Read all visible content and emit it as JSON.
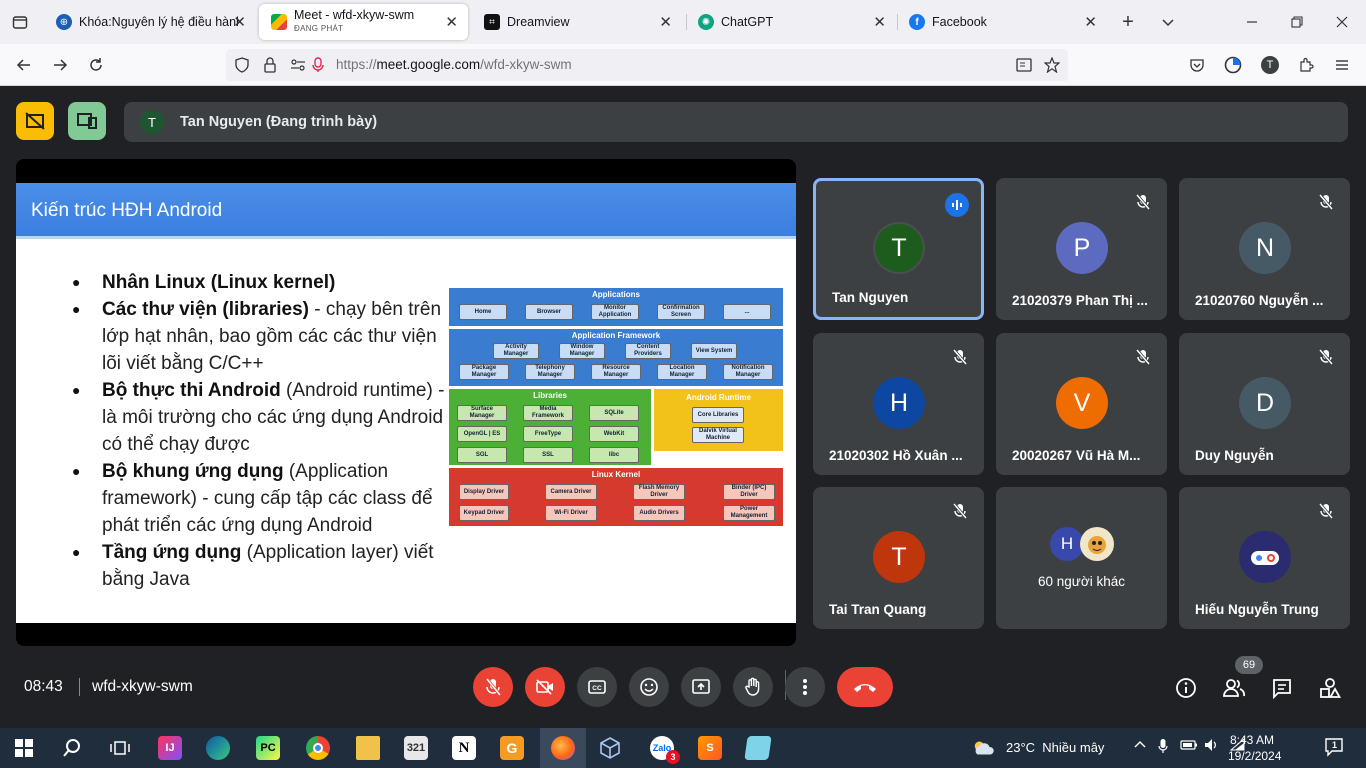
{
  "browser": {
    "tabs": [
      {
        "title": "Khóa:Nguyên lý hệ điều hành",
        "favicon": "moodle-icon",
        "active": false
      },
      {
        "title": "Meet - wfd-xkyw-swm",
        "subtitle": "ĐANG PHÁT",
        "favicon": "google-meet-icon",
        "active": true
      },
      {
        "title": "Dreamview",
        "favicon": "dreamview-icon",
        "active": false
      },
      {
        "title": "ChatGPT",
        "favicon": "chatgpt-icon",
        "active": false
      },
      {
        "title": "Facebook",
        "favicon": "facebook-icon",
        "active": false
      }
    ],
    "url": {
      "prefix": "https://",
      "host": "meet.google.com",
      "path": "/wfd-xkyw-swm"
    },
    "profile_initial": "T"
  },
  "meet": {
    "presenter": {
      "initial": "T",
      "label": "Tan Nguyen (Đang trình bày)"
    },
    "slide": {
      "title": "Kiến trúc HĐH Android",
      "bullets": [
        {
          "bold": "Nhân Linux (Linux kernel)",
          "rest": ""
        },
        {
          "bold": "Các thư viện (libraries)",
          "rest": " - chạy bên trên lớp hạt nhân, bao gồm các các thư viện lõi viết bằng C/C++"
        },
        {
          "bold": "Bộ thực thi Android",
          "rest": " (Android runtime) - là môi trường cho các ứng dụng Android có thể chạy được"
        },
        {
          "bold": "Bộ khung ứng dụng",
          "rest": " (Application framework) - cung cấp tập các class để phát triển các ứng dụng Android"
        },
        {
          "bold": "Tầng ứng dụng",
          "rest": " (Application layer) viết bằng Java"
        }
      ],
      "diagram": {
        "applications": {
          "title": "Applications",
          "items": [
            "Home",
            "Browser",
            "Monitor Application",
            "Confirmation Screen",
            "..."
          ]
        },
        "framework": {
          "title": "Application Framework",
          "row1": [
            "Activity Manager",
            "Window Manager",
            "Content Providers",
            "View System"
          ],
          "row2": [
            "Package Manager",
            "Telephony Manager",
            "Resource Manager",
            "Location Manager",
            "Notification Manager"
          ]
        },
        "libraries": {
          "title": "Libraries",
          "items": [
            "Surface Manager",
            "Media Framework",
            "SQLite",
            "OpenGL | ES",
            "FreeType",
            "WebKit",
            "SGL",
            "SSL",
            "libc"
          ]
        },
        "runtime": {
          "title": "Android Runtime",
          "items": [
            "Core Libraries",
            "Dalvik Virtual Machine"
          ]
        },
        "kernel": {
          "title": "Linux Kernel",
          "items": [
            "Display Driver",
            "Camera Driver",
            "Flash Memory Driver",
            "Binder (IPC) Driver",
            "Keypad Driver",
            "Wi-Fi Driver",
            "Audio Drivers",
            "Power Management"
          ]
        }
      }
    },
    "participants": [
      {
        "initial": "T",
        "name": "Tan Nguyen",
        "color": "#1e5c1e",
        "speaking": true
      },
      {
        "initial": "P",
        "name": "21020379 Phan Thị ...",
        "color": "#5c6bc0",
        "speaking": false
      },
      {
        "initial": "N",
        "name": "21020760 Nguyễn ...",
        "color": "#455a64",
        "speaking": false
      },
      {
        "initial": "H",
        "name": "21020302 Hồ Xuân ...",
        "color": "#0d47a1",
        "speaking": false
      },
      {
        "initial": "V",
        "name": "20020267 Vũ Hà M...",
        "color": "#ef6c00",
        "speaking": false
      },
      {
        "initial": "D",
        "name": "Duy Nguyễn",
        "color": "#455a64",
        "speaking": false
      },
      {
        "initial": "T",
        "name": "Tai Tran Quang",
        "color": "#bf360c",
        "speaking": false
      },
      {
        "initial": "H",
        "name": "60 người khác",
        "color": "#3949ab",
        "speaking": false
      },
      {
        "initial": "",
        "name": "Hiếu Nguyễn Trung",
        "color": "#2b2c6f",
        "speaking": false
      }
    ],
    "bottom": {
      "time": "08:43",
      "meeting_code": "wfd-xkyw-swm",
      "people_count": "69"
    }
  },
  "taskbar": {
    "weather": {
      "temp": "23°C",
      "desc": "Nhiều mây"
    },
    "time": "8:43 AM",
    "date": "19/2/2024",
    "notification_count": "1",
    "zalo_badge": "3"
  }
}
